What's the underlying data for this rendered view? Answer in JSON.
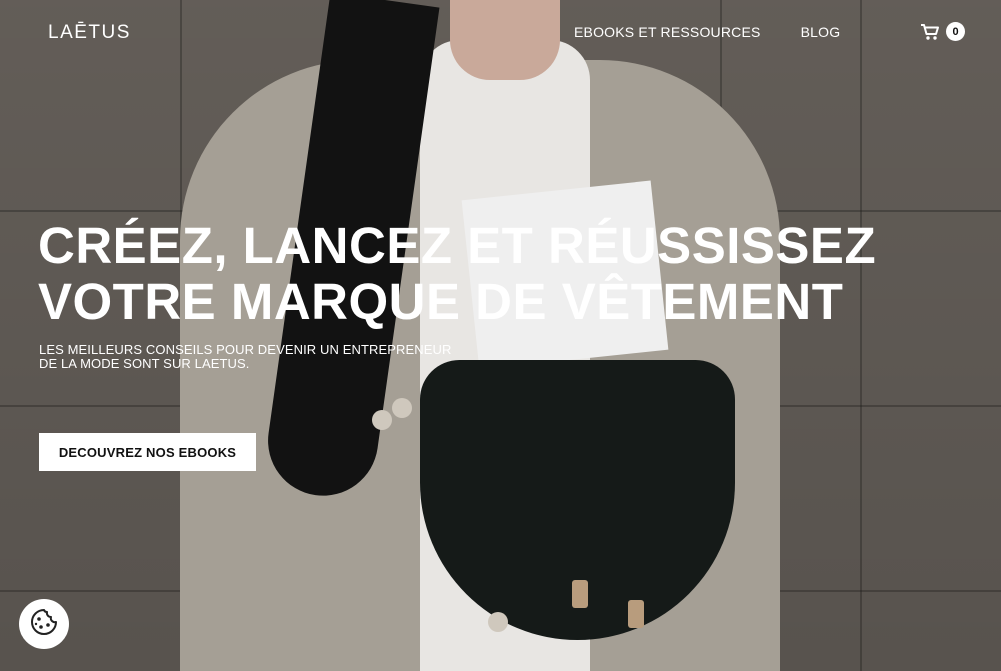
{
  "brand": {
    "logo": "LAĒTUS"
  },
  "nav": {
    "items": [
      {
        "label": "EBOOKS ET RESSOURCES"
      },
      {
        "label": "BLOG"
      }
    ]
  },
  "cart": {
    "icon": "cart-icon",
    "count": "0"
  },
  "hero": {
    "title_line1": "CRÉEZ, LANCEZ ET RÉUSSISSEZ",
    "title_line2": "VOTRE MARQUE DE VÊTEMENT",
    "subtitle_line1": "LES MEILLEURS CONSEILS POUR DEVENIR UN ENTREPRENEUR",
    "subtitle_line2": "DE LA MODE SONT SUR LAETUS.",
    "cta_label": "DECOUVREZ NOS EBOOKS"
  },
  "cookie": {
    "icon": "cookie-icon"
  },
  "colors": {
    "text": "#ffffff",
    "button_bg": "#ffffff",
    "button_text": "#111111"
  }
}
